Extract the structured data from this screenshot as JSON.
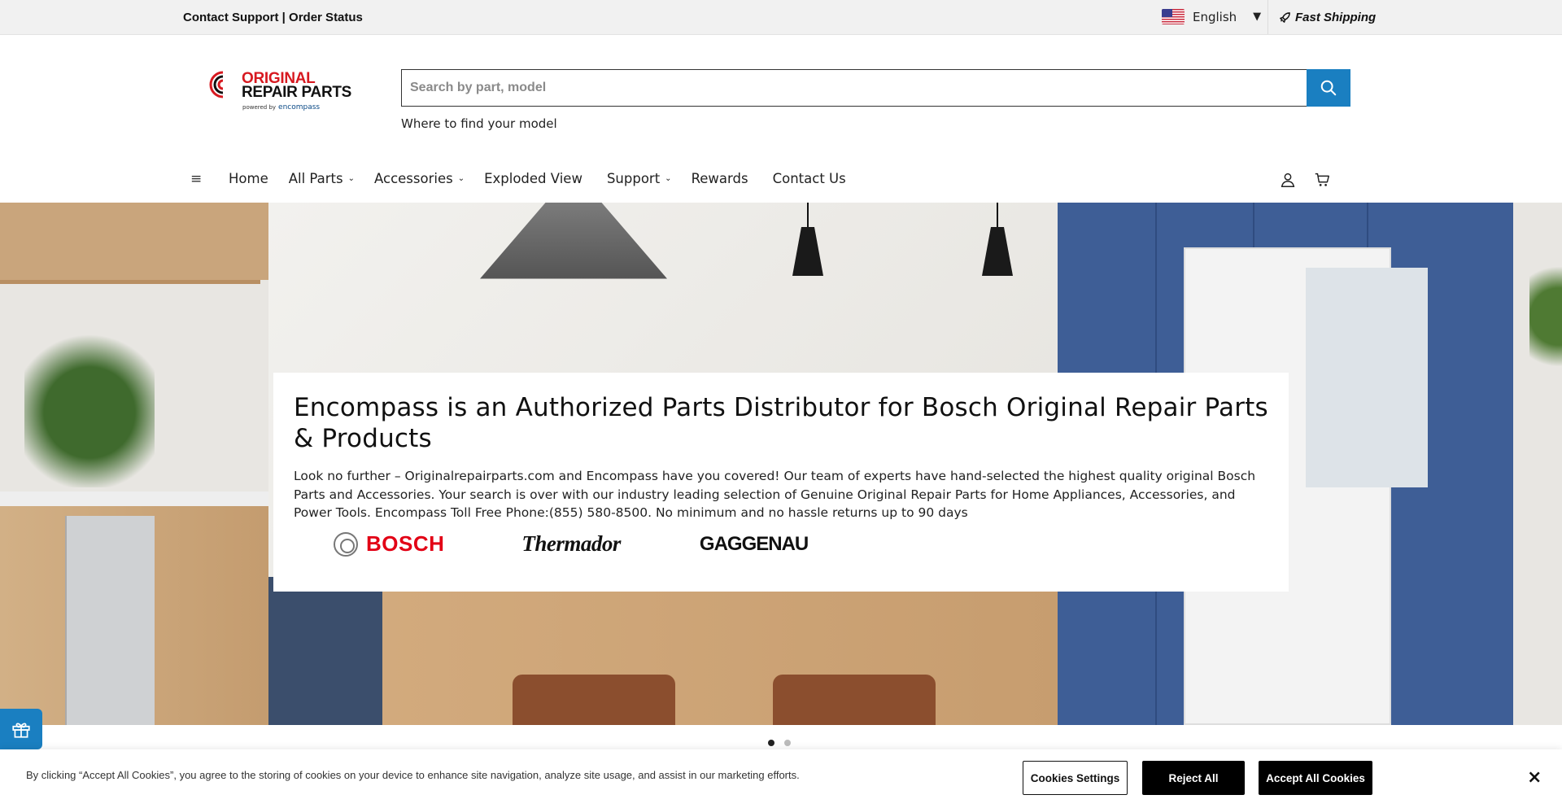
{
  "topbar": {
    "contact_support": "Contact Support",
    "separator": " | ",
    "order_status": "Order Status",
    "language": "English",
    "fast_shipping": "Fast Shipping"
  },
  "logo": {
    "line1": "ORIGINAL",
    "line2": "REPAIR PARTS",
    "powered_by": "powered by",
    "partner": "encompass"
  },
  "search": {
    "placeholder": "Search by part, model",
    "value": "",
    "find_model_link": "Where to find your model"
  },
  "nav": {
    "menu_icon": "≡",
    "items": [
      {
        "label": "Home",
        "dropdown": false
      },
      {
        "label": "All Parts",
        "dropdown": true
      },
      {
        "label": "Accessories",
        "dropdown": true
      },
      {
        "label": "Exploded View",
        "dropdown": false
      },
      {
        "label": "Support",
        "dropdown": true
      },
      {
        "label": "Rewards",
        "dropdown": false
      },
      {
        "label": "Contact Us",
        "dropdown": false
      }
    ],
    "icons": [
      "account-icon",
      "cart-icon"
    ]
  },
  "hero": {
    "title": "Encompass is an Authorized Parts Distributor for Bosch Original Repair Parts & Products",
    "body": "Look no further – Originalrepairparts.com and Encompass have you covered! Our team of experts have hand-selected the highest quality original Bosch Parts and Accessories. Your search is over with our industry leading selection of Genuine Original Repair Parts for Home Appliances, Accessories, and Power Tools. Encompass Toll Free Phone:(855) 580-8500. No minimum and no hassle returns up to 90 days",
    "brands": [
      "BOSCH",
      "Thermador",
      "GAGGENAU"
    ]
  },
  "carousel": {
    "slides": 2,
    "active_index": 0
  },
  "cookie": {
    "text": "By clicking “Accept All Cookies”, you agree to the storing of cookies on your device to enhance site navigation, analyze site usage, and assist in our marketing efforts.",
    "settings_label": "Cookies Settings",
    "reject_label": "Reject All",
    "accept_label": "Accept All Cookies",
    "close_label": "×"
  },
  "colors": {
    "accent": "#1a7fc1",
    "brand_red": "#d71920",
    "bosch_red": "#e20015"
  }
}
